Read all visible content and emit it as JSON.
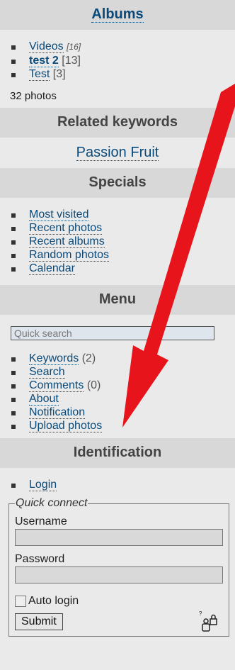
{
  "albums": {
    "title": "Albums",
    "items": [
      {
        "label": "Videos",
        "count": "[16]"
      },
      {
        "label": "test 2",
        "count": "[13]"
      },
      {
        "label": "Test",
        "count": "[3]"
      }
    ],
    "summary": "32 photos"
  },
  "related": {
    "title": "Related keywords",
    "keyword": "Passion Fruit"
  },
  "specials": {
    "title": "Specials",
    "items": [
      "Most visited",
      "Recent photos",
      "Recent albums",
      "Random photos",
      "Calendar"
    ]
  },
  "menu": {
    "title": "Menu",
    "search_placeholder": "Quick search",
    "items": [
      {
        "label": "Keywords",
        "count": "(2)"
      },
      {
        "label": "Search",
        "count": ""
      },
      {
        "label": "Comments",
        "count": "(0)"
      },
      {
        "label": "About",
        "count": ""
      },
      {
        "label": "Notification",
        "count": ""
      },
      {
        "label": "Upload photos",
        "count": ""
      }
    ]
  },
  "identification": {
    "title": "Identification",
    "login_label": "Login",
    "quick_connect": {
      "legend": "Quick connect",
      "username_label": "Username",
      "password_label": "Password",
      "auto_login_label": "Auto login",
      "submit_label": "Submit"
    }
  },
  "overlay": {
    "arrow_color": "#e8141c"
  },
  "icons": {
    "lock": "users-lock-icon"
  }
}
